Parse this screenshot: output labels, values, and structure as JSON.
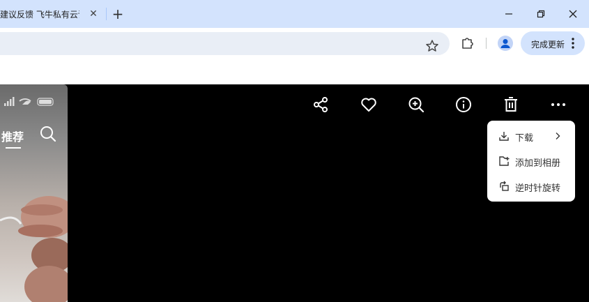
{
  "browser": {
    "tab": {
      "title": "建议反馈 飞牛私有云论",
      "close_glyph": "✕"
    },
    "newtab_glyph": "+",
    "window_controls": [
      "minimize-icon",
      "restore-icon",
      "close-icon"
    ],
    "toolbar": {
      "update_button_label": "完成更新"
    },
    "accent_color": "#d3e3fd"
  },
  "viewer": {
    "photo": {
      "tab_label": "推荐"
    },
    "toolbar_icons": [
      "share-icon",
      "heart-icon",
      "zoom-in-icon",
      "info-icon",
      "delete-icon",
      "more-icon"
    ],
    "more_menu": {
      "items": [
        {
          "label": "下载",
          "icon": "download-icon",
          "has_submenu": true
        },
        {
          "label": "添加到相册",
          "icon": "add-to-album-icon",
          "has_submenu": false
        },
        {
          "label": "逆时针旋转",
          "icon": "rotate-ccw-icon",
          "has_submenu": false
        }
      ]
    }
  }
}
